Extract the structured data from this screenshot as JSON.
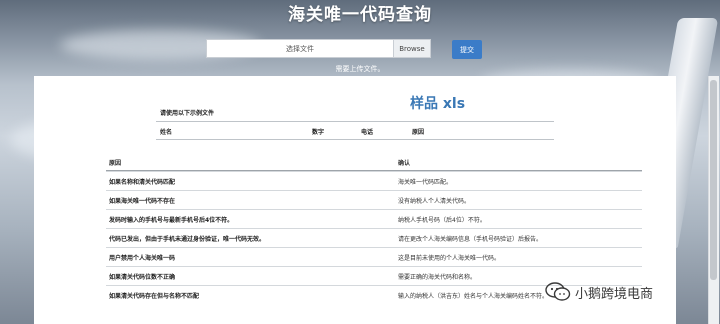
{
  "header": {
    "title": "海关唯一代码查询"
  },
  "upload": {
    "placeholder": "选择文件",
    "browse_label": "Browse",
    "submit_label": "提交",
    "hint": "需要上传文件。"
  },
  "sample": {
    "title": "样品 xls",
    "caption": "请使用以下示例文件",
    "columns": [
      "姓名",
      "数字",
      "电话",
      "原因"
    ]
  },
  "results": {
    "headers": {
      "cause": "原因",
      "confirm": "确认"
    },
    "rows": [
      {
        "cause": "如果名称和清关代码匹配",
        "confirm": "海关唯一代码匹配。"
      },
      {
        "cause": "如果海关唯一代码不存在",
        "confirm": "没有纳税人个人清关代码。"
      },
      {
        "cause": "发码时输入的手机号与最新手机号后4位不符。",
        "confirm": "纳税人手机号码（后4位）不符。"
      },
      {
        "cause": "代码已发出，但由于手机未通过身份验证，唯一代码无效。",
        "confirm": "请在更改个人海关编码信息（手机号码验证）后报告。"
      },
      {
        "cause": "用户禁用个人海关唯一码",
        "confirm": "这是目前未使用的个人海关唯一代码。"
      },
      {
        "cause": "如果清关代码位数不正确",
        "confirm": "需要正确的海关代码和名称。"
      },
      {
        "cause": "如果清关代码存在但与名称不匹配",
        "confirm": "输入的纳税人（洪吉东）姓名与个人海关编码姓名不符。"
      }
    ]
  },
  "watermark": {
    "text": "小鹅跨境电商",
    "icon": "wechat-icon"
  },
  "colors": {
    "submit": "#3b7cc8",
    "sample_title": "#3a78b5",
    "panel": "#ffffff"
  }
}
